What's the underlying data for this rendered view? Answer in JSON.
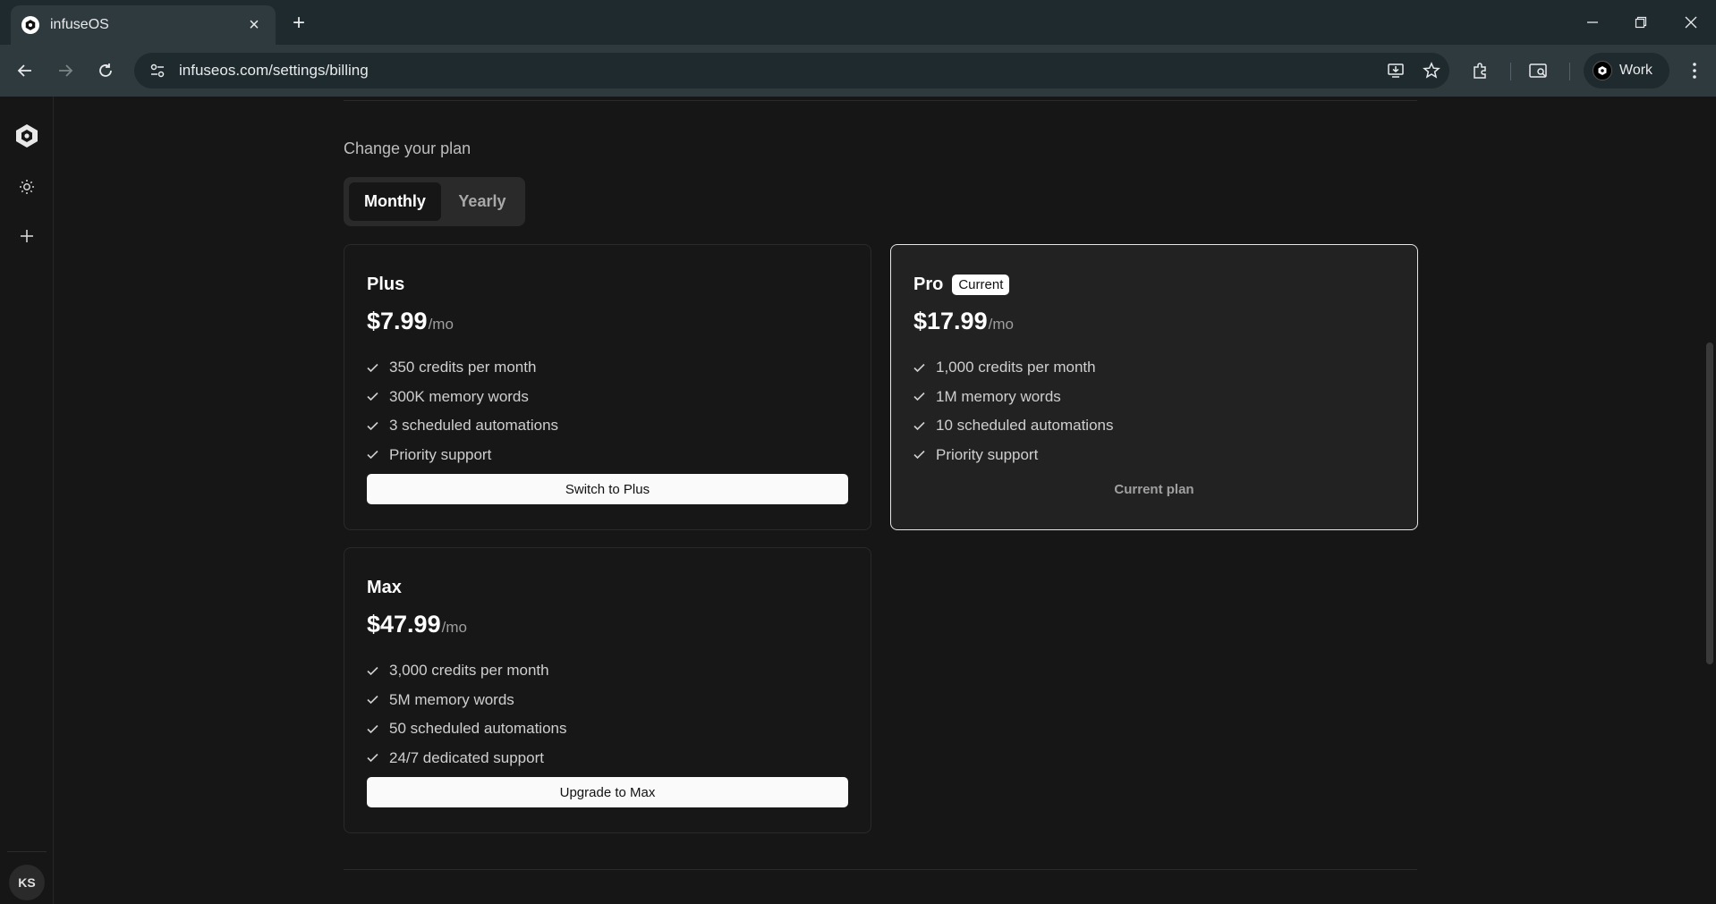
{
  "browser": {
    "tab_title": "infuseOS",
    "url": "infuseos.com/settings/billing",
    "profile_name": "Work"
  },
  "sidebar": {
    "avatar_initials": "KS"
  },
  "billing": {
    "heading": "Change your plan",
    "toggle": {
      "monthly": "Monthly",
      "yearly": "Yearly",
      "selected": "Monthly"
    },
    "plans": [
      {
        "name": "Plus",
        "price": "$7.99",
        "period": "/mo",
        "features": [
          "350 credits per month",
          "300K memory words",
          "3 scheduled automations",
          "Priority support"
        ],
        "action": "Switch to Plus"
      },
      {
        "name": "Pro",
        "badge": "Current",
        "price": "$17.99",
        "period": "/mo",
        "features": [
          "1,000 credits per month",
          "1M memory words",
          "10 scheduled automations",
          "Priority support"
        ],
        "action": "Current plan"
      },
      {
        "name": "Max",
        "price": "$47.99",
        "period": "/mo",
        "features": [
          "3,000 credits per month",
          "5M memory words",
          "50 scheduled automations",
          "24/7 dedicated support"
        ],
        "action": "Upgrade to Max"
      }
    ]
  },
  "colors": {
    "background": "#161616",
    "card": "#171717",
    "card_current": "#222222",
    "browser_frame": "#1f2a2e",
    "toolbar": "#2f3a3e"
  }
}
